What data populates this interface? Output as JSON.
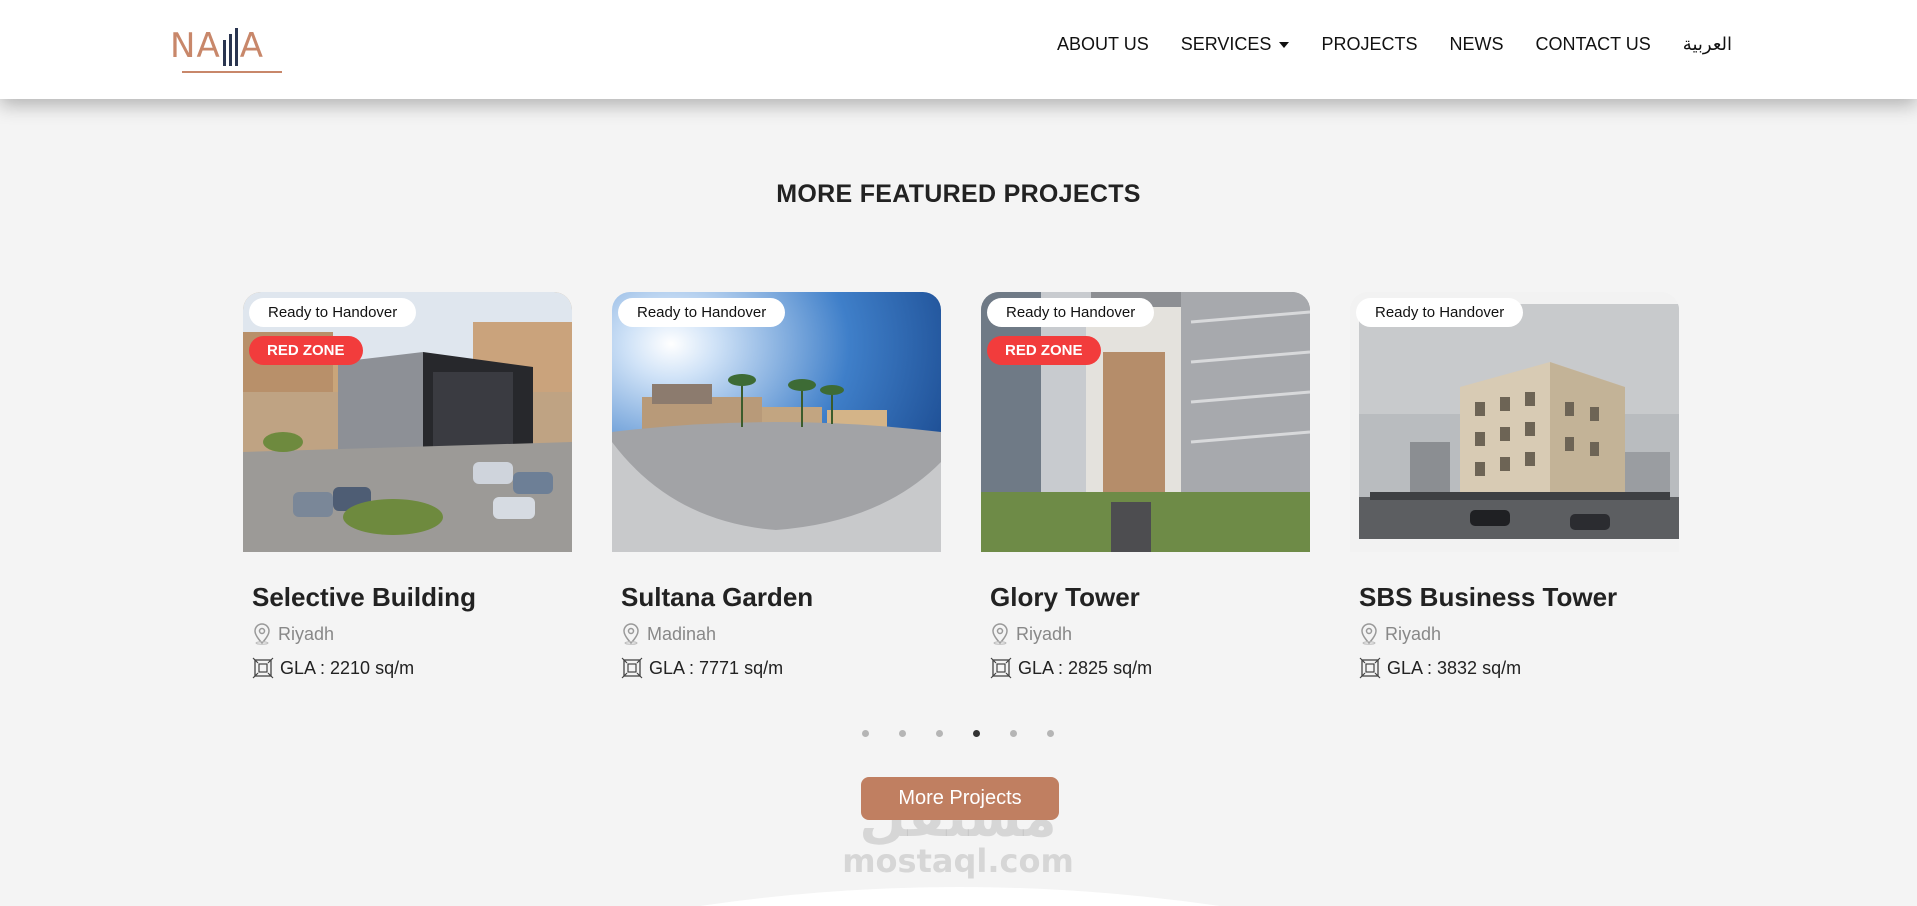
{
  "header": {
    "logo_alt": "NAJIA",
    "nav": [
      {
        "label": "ABOUT US"
      },
      {
        "label": "SERVICES",
        "has_dropdown": true
      },
      {
        "label": "PROJECTS"
      },
      {
        "label": "NEWS"
      },
      {
        "label": "CONTACT US"
      },
      {
        "label": "العربية"
      }
    ]
  },
  "section": {
    "title": "MORE FEATURED PROJECTS"
  },
  "projects": [
    {
      "status": "Ready to Handover",
      "zone": "RED ZONE",
      "name": "Selective Building",
      "city": "Riyadh",
      "gla": "GLA : 2210 sq/m"
    },
    {
      "status": "Ready to Handover",
      "zone": "",
      "name": "Sultana Garden",
      "city": "Madinah",
      "gla": "GLA : 7771 sq/m"
    },
    {
      "status": "Ready to Handover",
      "zone": "RED ZONE",
      "name": "Glory Tower",
      "city": "Riyadh",
      "gla": "GLA : 2825 sq/m"
    },
    {
      "status": "Ready to Handover",
      "zone": "",
      "name": "SBS Business Tower",
      "city": "Riyadh",
      "gla": "GLA : 3832 sq/m"
    }
  ],
  "carousel": {
    "total": 6,
    "active_index": 3
  },
  "cta": {
    "label": "More Projects"
  },
  "watermark": {
    "arabic": "مستقل",
    "latin": "mostaql.com"
  },
  "colors": {
    "accent": "#c07f61",
    "red_zone": "#f23c3c",
    "logo_dark": "#2a3550"
  }
}
